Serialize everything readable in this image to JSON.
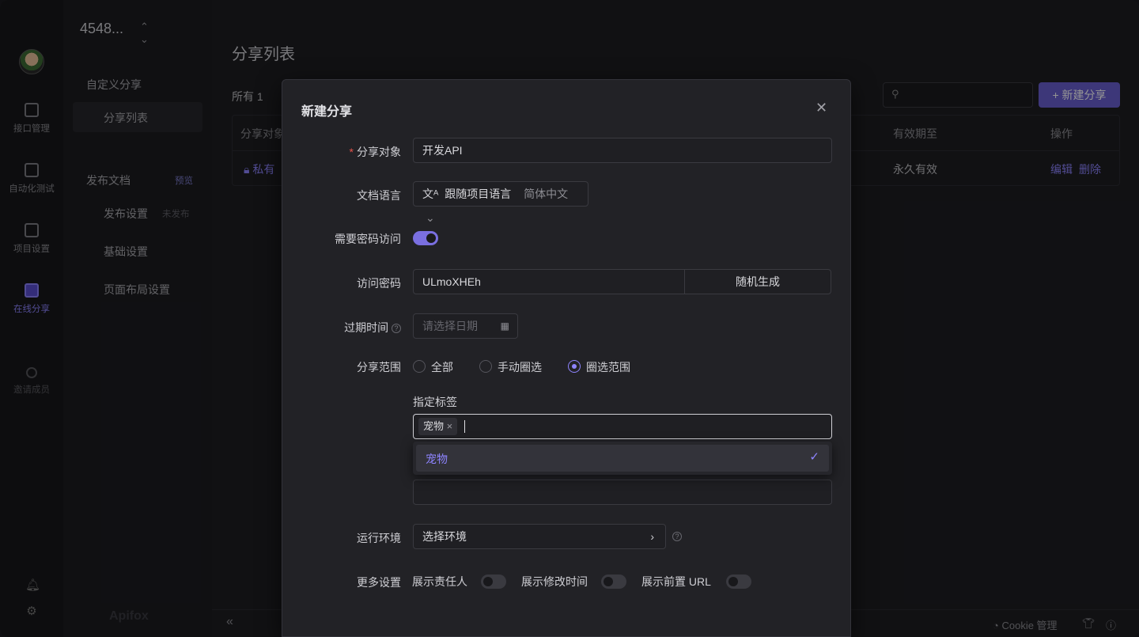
{
  "project": {
    "title": "4548..."
  },
  "rail": {
    "items": [
      {
        "label": "接口管理"
      },
      {
        "label": "自动化测试"
      },
      {
        "label": "项目设置"
      },
      {
        "label": "在线分享"
      },
      {
        "label": "邀请成员"
      }
    ]
  },
  "sidebar": {
    "custom_share": "自定义分享",
    "share_list": "分享列表",
    "publish_docs": "发布文档",
    "preview": "预览",
    "publish_settings": "发布设置",
    "not_published": "未发布",
    "basic_settings": "基础设置",
    "layout_settings": "页面布局设置",
    "brand": "Apifox"
  },
  "main": {
    "title": "分享列表",
    "all_count": "所有 1",
    "new_share_button": "+ 新建分享",
    "table": {
      "headers": [
        "分享对象",
        "有效期至",
        "操作"
      ],
      "row": {
        "object": "私有",
        "expiry": "永久有效",
        "edit": "编辑",
        "delete": "删除"
      }
    },
    "footer": {
      "cookie": "Cookie 管理"
    }
  },
  "modal": {
    "title": "新建分享",
    "share_target": {
      "label": "分享对象",
      "value": "开发API"
    },
    "doc_language": {
      "label": "文档语言",
      "value": "跟随项目语言",
      "sub": "简体中文"
    },
    "need_password": {
      "label": "需要密码访问",
      "on": true
    },
    "password": {
      "label": "访问密码",
      "value": "ULmoXHEh",
      "random_button": "随机生成"
    },
    "expire": {
      "label": "过期时间",
      "placeholder": "请选择日期"
    },
    "scope": {
      "label": "分享范围",
      "options": [
        "全部",
        "手动圈选",
        "圈选范围"
      ],
      "selected": 2
    },
    "tags": {
      "label": "指定标签",
      "chips": [
        "宠物"
      ],
      "dropdown_option": "宠物"
    },
    "env": {
      "label": "运行环境",
      "placeholder": "选择环境"
    },
    "more": {
      "label": "更多设置",
      "show_owner": "展示责任人",
      "show_modified": "展示修改时间",
      "show_prefix_url": "展示前置 URL"
    }
  },
  "colors": {
    "accent": "#8e84ff",
    "primary_button": "#6a5fd0"
  }
}
